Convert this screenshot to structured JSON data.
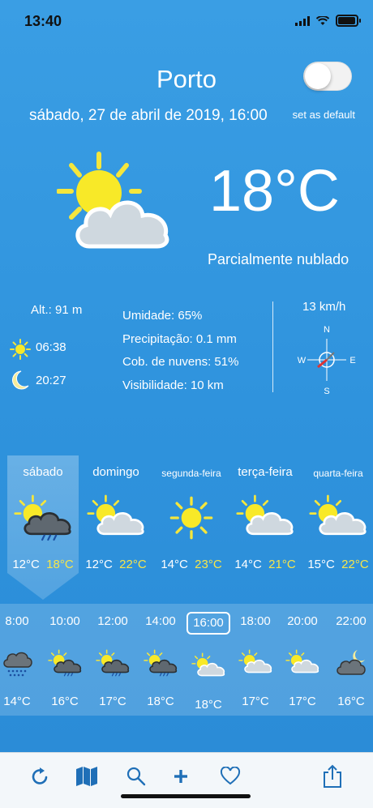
{
  "status_bar": {
    "time": "13:40"
  },
  "header": {
    "city": "Porto",
    "date": "sábado, 27 de abril de 2019, 16:00",
    "default_label": "set as default",
    "default_on": false
  },
  "current": {
    "temperature": "18°C",
    "condition": "Parcialmente nublado",
    "icon": "partly-cloudy-icon"
  },
  "info": {
    "altitude": "Alt.: 91 m",
    "sunrise": "06:38",
    "sunset": "20:27",
    "humidity": "Umidade: 65%",
    "precipitation": "Precipitação: 0.1 mm",
    "cloud_cover": "Cob. de nuvens: 51%",
    "visibility": "Visibilidade: 10 km"
  },
  "wind": {
    "speed": "13 km/h",
    "compass": {
      "n": "N",
      "s": "S",
      "e": "E",
      "w": "W"
    }
  },
  "days": [
    {
      "name": "sábado",
      "min": "12°C",
      "max": "18°C",
      "icon": "rain-partly-cloudy-icon",
      "selected": true
    },
    {
      "name": "domingo",
      "min": "12°C",
      "max": "22°C",
      "icon": "partly-cloudy-icon"
    },
    {
      "name": "segunda-feira",
      "min": "14°C",
      "max": "23°C",
      "icon": "sun-icon"
    },
    {
      "name": "terça-feira",
      "min": "14°C",
      "max": "21°C",
      "icon": "partly-cloudy-icon"
    },
    {
      "name": "quarta-feira",
      "min": "15°C",
      "max": "22°C",
      "icon": "partly-cloudy-icon"
    }
  ],
  "hours": [
    {
      "time": "8:00",
      "temp": "14°C",
      "icon": "cloud-drizzle-icon"
    },
    {
      "time": "10:00",
      "temp": "16°C",
      "icon": "sun-cloud-rain-icon"
    },
    {
      "time": "12:00",
      "temp": "17°C",
      "icon": "sun-cloud-rain-icon"
    },
    {
      "time": "14:00",
      "temp": "18°C",
      "icon": "sun-cloud-rain-icon"
    },
    {
      "time": "16:00",
      "temp": "18°C",
      "icon": "partly-cloudy-icon",
      "selected": true
    },
    {
      "time": "18:00",
      "temp": "17°C",
      "icon": "partly-cloudy-icon"
    },
    {
      "time": "20:00",
      "temp": "17°C",
      "icon": "partly-cloudy-icon"
    },
    {
      "time": "22:00",
      "temp": "16°C",
      "icon": "moon-cloud-icon"
    }
  ],
  "tabbar": {
    "items": [
      "refresh-icon",
      "map-icon",
      "search-icon",
      "add-icon",
      "favorite-icon",
      "share-icon"
    ]
  }
}
